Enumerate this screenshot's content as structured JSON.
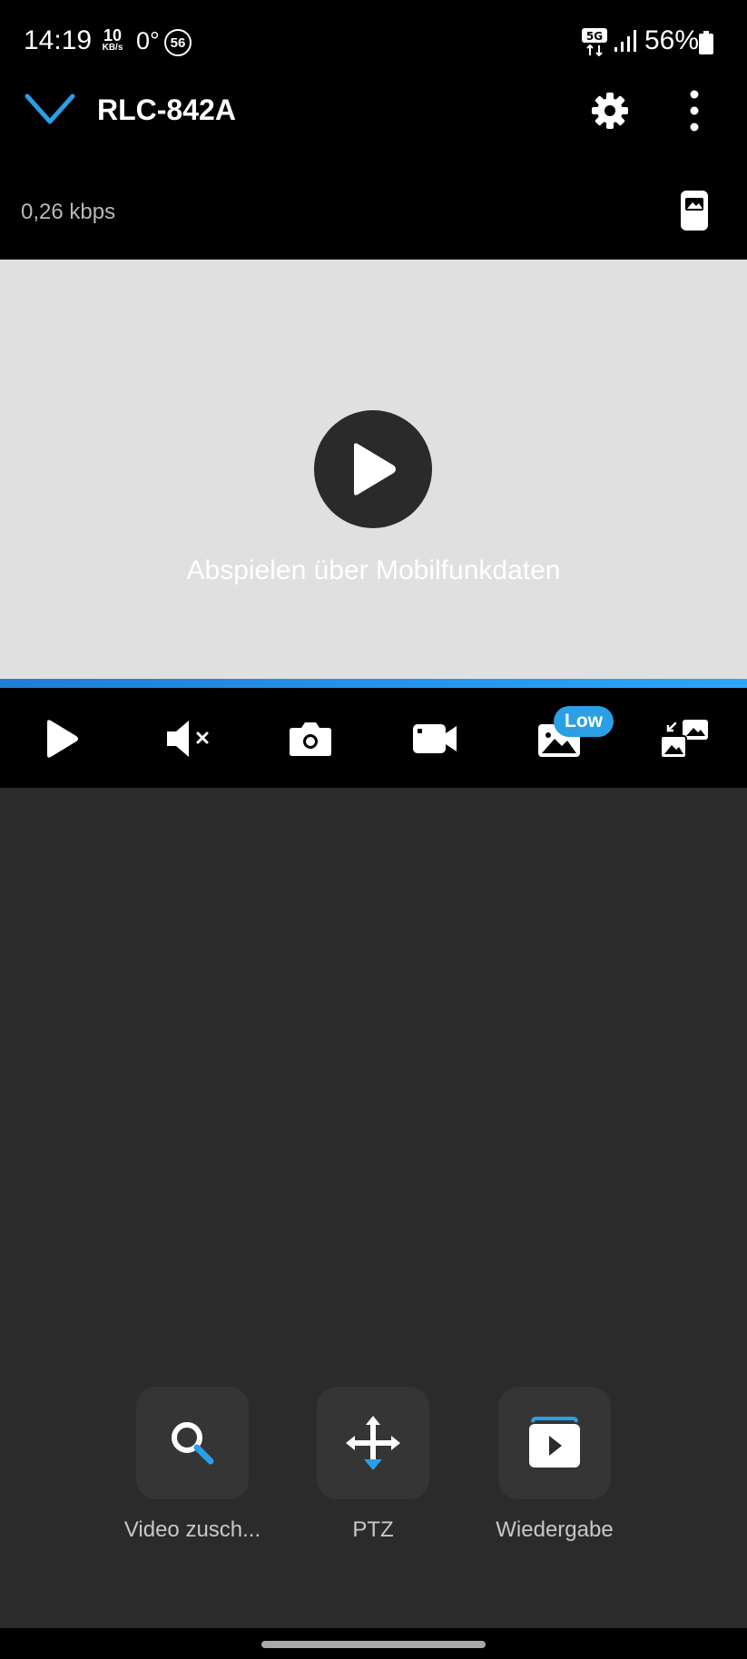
{
  "status_bar": {
    "time": "14:19",
    "net_speed_value": "10",
    "net_speed_unit": "KB/s",
    "temperature": "0°",
    "notification_count": "56",
    "network": "5G",
    "battery": "56%"
  },
  "header": {
    "title": "RLC-842A",
    "bitrate": "0,26 kbps"
  },
  "video": {
    "message": "Abspielen über Mobilfunkdaten"
  },
  "toolbar": {
    "quality_badge": "Low"
  },
  "actions": [
    {
      "label": "Video zusch..."
    },
    {
      "label": "PTZ"
    },
    {
      "label": "Wiedergabe"
    }
  ],
  "colors": {
    "accent": "#2b9fe6",
    "header_bg": "#000000",
    "video_bg": "#e0e0e0",
    "panel_bg": "#2b2b2b"
  }
}
